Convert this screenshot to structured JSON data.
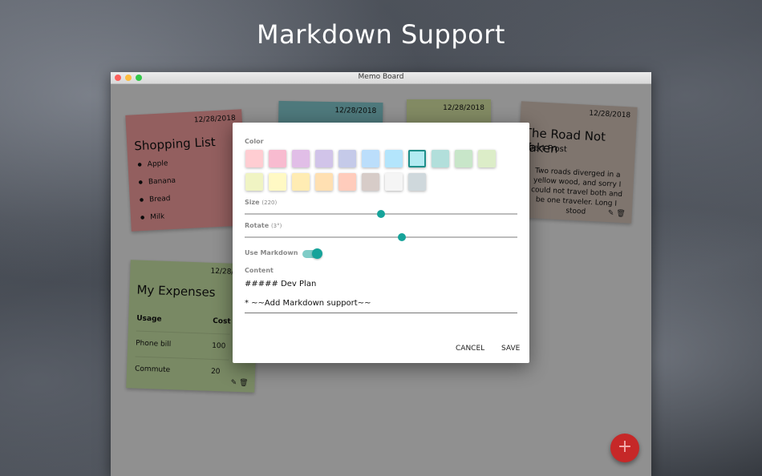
{
  "headline": "Markdown Support",
  "window": {
    "title": "Memo Board"
  },
  "notes": [
    {
      "date": "12/28/2018",
      "title": "Shopping List",
      "items": [
        "Apple",
        "Banana",
        "Bread",
        "Milk"
      ],
      "color": "#ee9a9a"
    },
    {
      "date": "12/28/2018",
      "color": "#7fc4c8"
    },
    {
      "date": "12/28/2018",
      "color": "#d2dfa0"
    },
    {
      "date": "12/28/2018",
      "title": "The Road Not Taken",
      "subtitle": "obert Frost",
      "body": "Two roads diverged in a yellow wood, and sorry I could not travel both and be one traveler. Long I stood",
      "color": "#cdbdb2"
    },
    {
      "date": "12/28/2018",
      "title": "My Expenses",
      "headers": [
        "Usage",
        "Cost"
      ],
      "rows": [
        [
          "Phone bill",
          "100"
        ],
        [
          "Commute",
          "20"
        ]
      ],
      "color": "#c4dea2"
    }
  ],
  "dialog": {
    "color_label": "Color",
    "colors_row1": [
      "#ffcdd2",
      "#f8bbd0",
      "#e1bee7",
      "#d1c4e9",
      "#c5cae9",
      "#bbdefb",
      "#b3e5fc",
      "#b2ebf2",
      "#b2dfdb",
      "#c8e6c9",
      "#dcedc8"
    ],
    "colors_row2": [
      "#f0f4c3",
      "#fff9c4",
      "#ffecb3",
      "#ffe0b2",
      "#ffccbc",
      "#d7ccc8",
      "#f5f5f5",
      "#cfd8dc"
    ],
    "selected_color": "#b2ebf2",
    "size_label": "Size",
    "size_value": "(220)",
    "size_pos": 0.5,
    "rotate_label": "Rotate",
    "rotate_value": "(3°)",
    "rotate_pos": 0.575,
    "markdown_label": "Use Markdown",
    "markdown_on": true,
    "content_label": "Content",
    "content_line1": "##### Dev Plan",
    "content_line2": "* ~~Add Markdown support~~",
    "cancel": "CANCEL",
    "save": "SAVE"
  },
  "fab_icon": "+",
  "icons": {
    "edit": "pencil-icon",
    "delete": "trash-icon"
  }
}
